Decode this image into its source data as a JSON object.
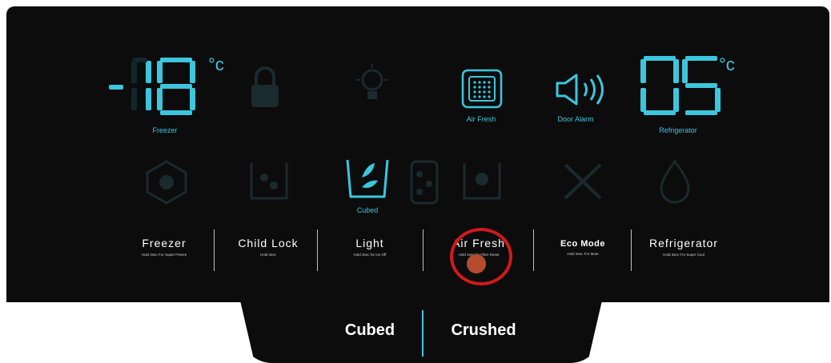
{
  "freezer": {
    "temp": "-18",
    "unit": "°c",
    "label": "Freezer"
  },
  "refrigerator": {
    "temp": "05",
    "unit": "°c",
    "label": "Refrigerator"
  },
  "indicators": {
    "air_fresh": "Air Fresh",
    "door_alarm": "Door Alarm",
    "cubed": "Cubed"
  },
  "buttons": [
    {
      "name": "Freezer",
      "sub": "Hold 3sec For Super Freeze"
    },
    {
      "name": "Child Lock",
      "sub": "Hold 3sec"
    },
    {
      "name": "Light",
      "sub": "Hold 3sec for Ice Off"
    },
    {
      "name": "Air Fresh",
      "sub": "Hold 3sec for Filter Reset"
    },
    {
      "name": "Eco Mode",
      "sub": "Hold 3sec For Mute"
    },
    {
      "name": "Refrigerator",
      "sub": "Hold 3sec For Super Cool"
    }
  ],
  "dispenser": {
    "cubed": "Cubed",
    "crushed": "Crushed"
  },
  "colors": {
    "accent": "#3cc6dd",
    "panel": "#0c0c0d",
    "highlight": "#d11a1a"
  }
}
